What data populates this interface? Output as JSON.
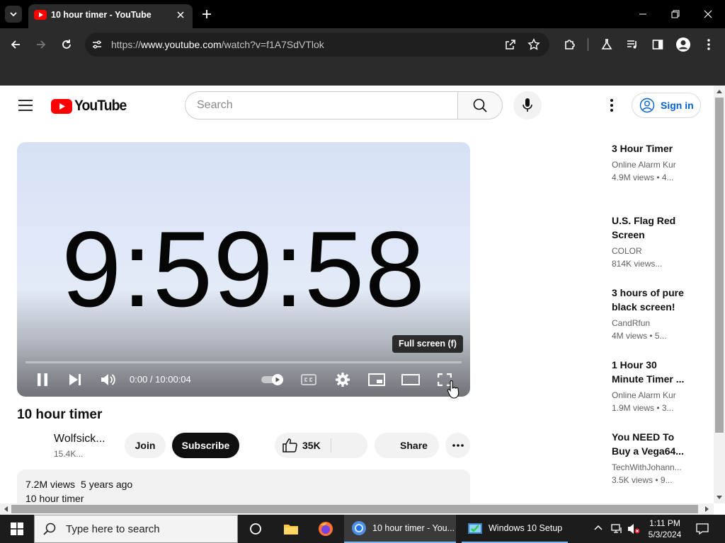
{
  "browser": {
    "tab_title": "10 hour timer - YouTube",
    "url_prefix": "https://",
    "url_host": "www.youtube.com",
    "url_path": "/watch?v=f1A7SdVTlok"
  },
  "youtube": {
    "logo_text": "YouTube",
    "search_placeholder": "Search",
    "signin_label": "Sign in",
    "player": {
      "timer_display": "9:59:58",
      "tooltip": "Full screen (f)",
      "time_current": "0:00",
      "time_separator": " / ",
      "time_total": "10:00:04",
      "progress": 0.0
    },
    "video": {
      "title": "10 hour timer",
      "channel": "Wolfsick...",
      "subscribers": "15.4K...",
      "join_label": "Join",
      "subscribe_label": "Subscribe",
      "likes": "35K",
      "share_label": "Share",
      "views": "7.2M views",
      "age": "5 years ago",
      "description": "10 hour timer"
    },
    "recommendations": [
      {
        "title": "3 Hour Timer",
        "channel": "Online Alarm Kur",
        "meta": "4.9M views  • 4..."
      },
      {
        "title": "U.S. Flag Red Screen",
        "channel": "COLOR",
        "meta": "814K views..."
      },
      {
        "title": "3 hours of pure black screen!",
        "channel": "CandRfun",
        "meta": "4M views  • 5..."
      },
      {
        "title": "1 Hour 30 Minute Timer ...",
        "channel": "Online Alarm Kur",
        "meta": "1.9M views  • 3..."
      },
      {
        "title": "You NEED To Buy a Vega64...",
        "channel": "TechWithJohann...",
        "meta": "3.5K views  • 9..."
      }
    ]
  },
  "taskbar": {
    "search_placeholder": "Type here to search",
    "apps": [
      {
        "label": "10 hour timer - You..."
      },
      {
        "label": "Windows 10 Setup"
      }
    ],
    "time": "1:11 PM",
    "date": "5/3/2024"
  },
  "colors": {
    "youtube_red": "#ff0000",
    "link_blue": "#065fd4",
    "chrome_dark": "#2b2b2b"
  }
}
